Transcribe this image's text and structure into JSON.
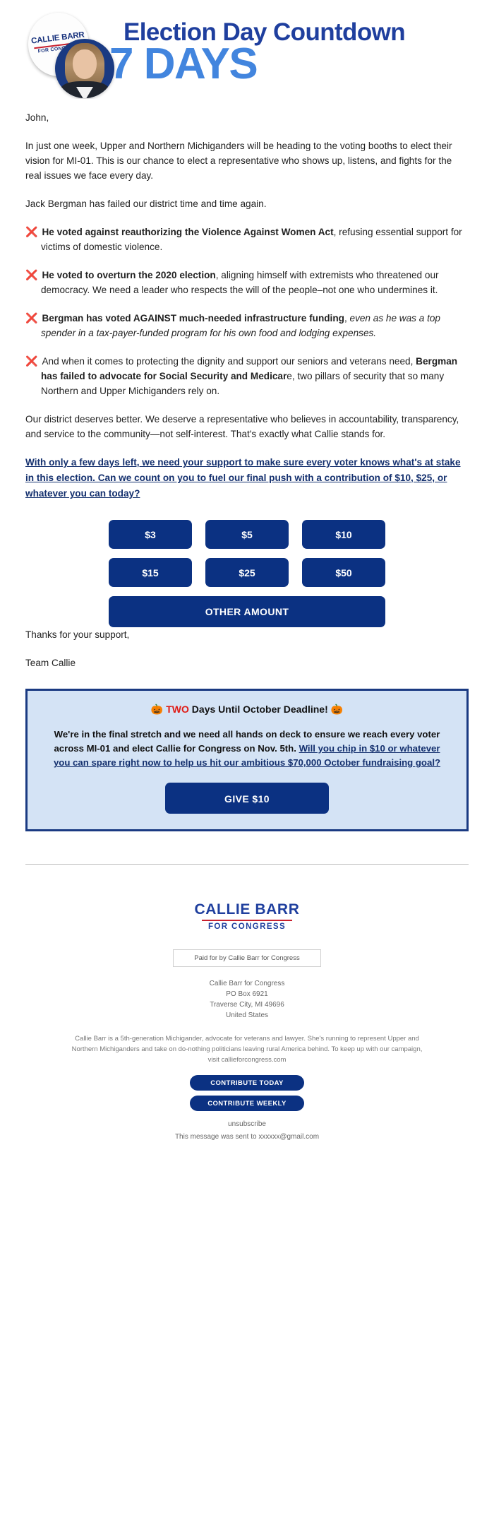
{
  "header": {
    "badge_name": "CALLIE BARR",
    "badge_sub": "FOR CONGRESS",
    "title": "Election Day Countdown",
    "countdown": "7 DAYS"
  },
  "body": {
    "salutation": "John,",
    "intro": "In just one week, Upper and Northern Michiganders will be heading to the voting booths to elect their vision for MI-01. This is our chance to elect a representative who shows up, listens, and fights for the real issues we face every day.",
    "lead": "Jack Bergman has failed our district time and time again.",
    "bullets": [
      {
        "icon": "cross-mark",
        "bold": "He voted against reauthorizing the Violence Against Women Act",
        "rest": ", refusing essential support for victims of domestic violence."
      },
      {
        "icon": "cross-mark",
        "bold": "He voted to overturn the 2020 election",
        "rest": ", aligning himself with extremists who threatened our democracy. We need a leader who respects the will of the people–not one who undermines it."
      },
      {
        "icon": "cross-mark",
        "bold": "Bergman has voted AGAINST much-needed infrastructure funding",
        "rest": ", ",
        "italic": "even as he was a top spender in a tax-payer-funded program for his own food and lodging expenses."
      },
      {
        "icon": "cross-mark",
        "pre": "And when it comes to protecting the dignity and support our seniors and veterans need, ",
        "bold": "Bergman has failed to advocate for Social Security and Medicar",
        "rest": "e, two pillars of security that so many Northern and Upper Michiganders rely on."
      }
    ],
    "closing": "Our district deserves better. We deserve a representative who believes in accountability, transparency, and service to the community—not self-interest. That's exactly what Callie stands for.",
    "cta_link": "With only a few days left, we need your support to make sure every voter knows what's at stake in this election. Can we count on you to fuel our final push with a contribution of $10, $25, or whatever you can today?",
    "thanks": "Thanks for your support,",
    "team": "Team Callie"
  },
  "donation": {
    "amounts_row1": [
      "$3",
      "$5",
      "$10"
    ],
    "amounts_row2": [
      "$15",
      "$25",
      "$50"
    ],
    "other_label": "OTHER AMOUNT"
  },
  "highlight": {
    "pumpkin_left": "🎃",
    "pumpkin_right": "🎃",
    "head_emphasis": "TWO",
    "head_rest": " Days Until October Deadline! ",
    "body_pre": "We're in the final stretch and we need all hands on deck to ensure we reach every voter across MI-01 and elect Callie for Congress on Nov. 5th. ",
    "body_link": "Will you chip in $10 or whatever you can spare right now to help us hit our ambitious $70,000 October fundraising goal?",
    "give_label": "GIVE $10"
  },
  "footer": {
    "logo_name": "CALLIE BARR",
    "logo_sub": "FOR CONGRESS",
    "paid_for": "Paid for by Callie Barr for Congress",
    "address": [
      "Callie Barr for Congress",
      "PO Box 6921",
      "Traverse City, MI 49696",
      "United States"
    ],
    "disclaimer": "Callie Barr is a 5th-generation Michigander, advocate for veterans and lawyer. She's running to represent Upper and Northern Michiganders and take on do-nothing politicians leaving rural America behind. To keep up with our campaign, visit callieforcongress.com",
    "btn_today": "CONTRIBUTE TODAY",
    "btn_weekly": "CONTRIBUTE WEEKLY",
    "unsubscribe": "unsubscribe",
    "sent_to": "This message was sent to xxxxxx@gmail.com"
  },
  "colors": {
    "navy": "#0b3182",
    "brand_blue": "#1f3f9e",
    "light_blue": "#4285de",
    "red": "#c8202e",
    "box_bg": "#d4e3f5"
  }
}
